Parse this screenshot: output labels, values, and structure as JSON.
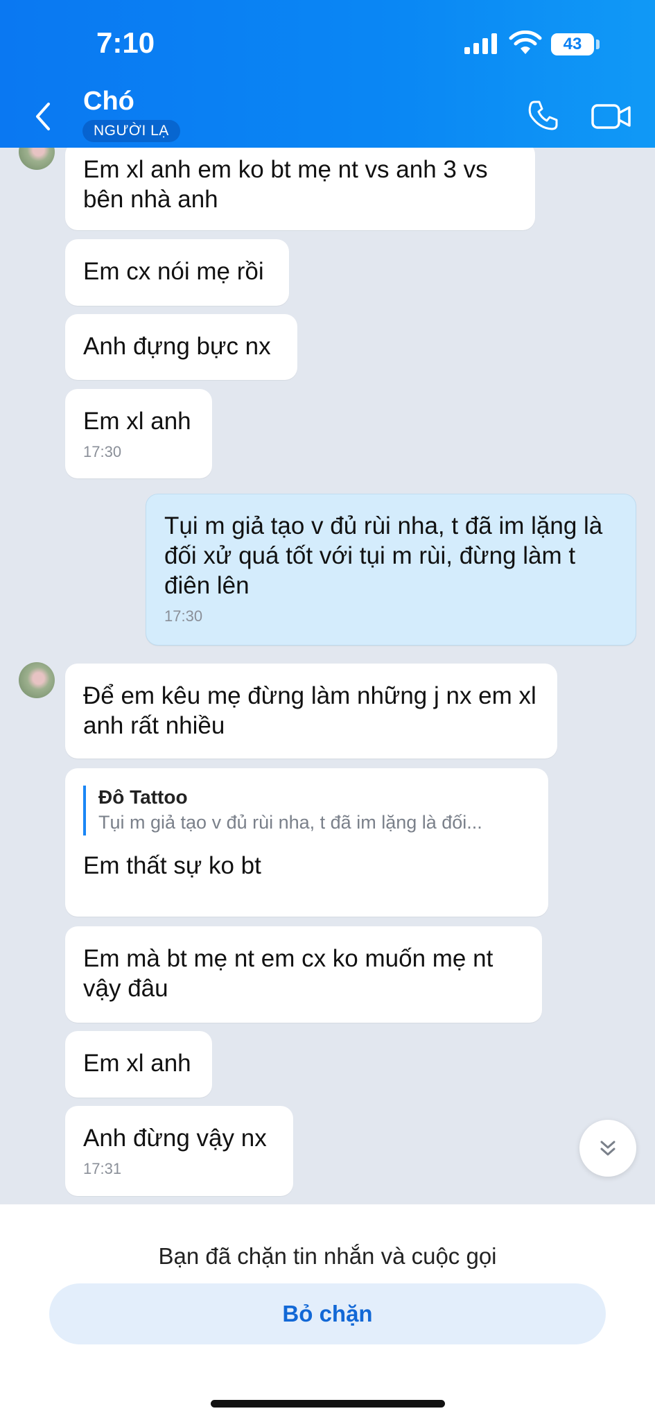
{
  "status_bar": {
    "time": "7:10",
    "battery": "43"
  },
  "header": {
    "title": "Chó",
    "badge": "NGƯỜI LẠ"
  },
  "messages": [
    {
      "text": "Em xl anh em ko bt mẹ nt vs anh 3 vs bên nhà anh"
    },
    {
      "text": "Em cx nói mẹ rồi"
    },
    {
      "text": "Anh đựng bực nx"
    },
    {
      "text": "Em xl anh",
      "time": "17:30"
    },
    {
      "text": "Tụi m giả tạo v đủ rùi nha, t đã im lặng là đối xử quá tốt với tụi m rùi, đừng làm t điên lên",
      "time": "17:30"
    },
    {
      "text": "Để em kêu mẹ đừng làm những j nx em xl anh rất nhiều"
    },
    {
      "quote_author": "Đô Tattoo",
      "quote_text": "Tụi m giả tạo v đủ rùi nha, t đã im lặng là đối...",
      "text": "Em thất sự ko bt"
    },
    {
      "text": "Em mà bt mẹ nt em cx ko muốn mẹ nt vậy đâu"
    },
    {
      "text": "Em xl anh"
    },
    {
      "text": "Anh đừng vậy nx",
      "time": "17:31"
    }
  ],
  "footer": {
    "blocked_text": "Bạn đã chặn tin nhắn và cuộc gọi",
    "unblock_label": "Bỏ chặn"
  },
  "icons": {
    "back": "chevron-left-icon",
    "call": "phone-icon",
    "video": "video-camera-icon",
    "scroll": "double-chevron-down-icon"
  },
  "colors": {
    "header": "#0a80f3",
    "mine_bubble": "#d4ecfc",
    "background": "#e2e7ef",
    "unblock_text": "#1268d6"
  }
}
